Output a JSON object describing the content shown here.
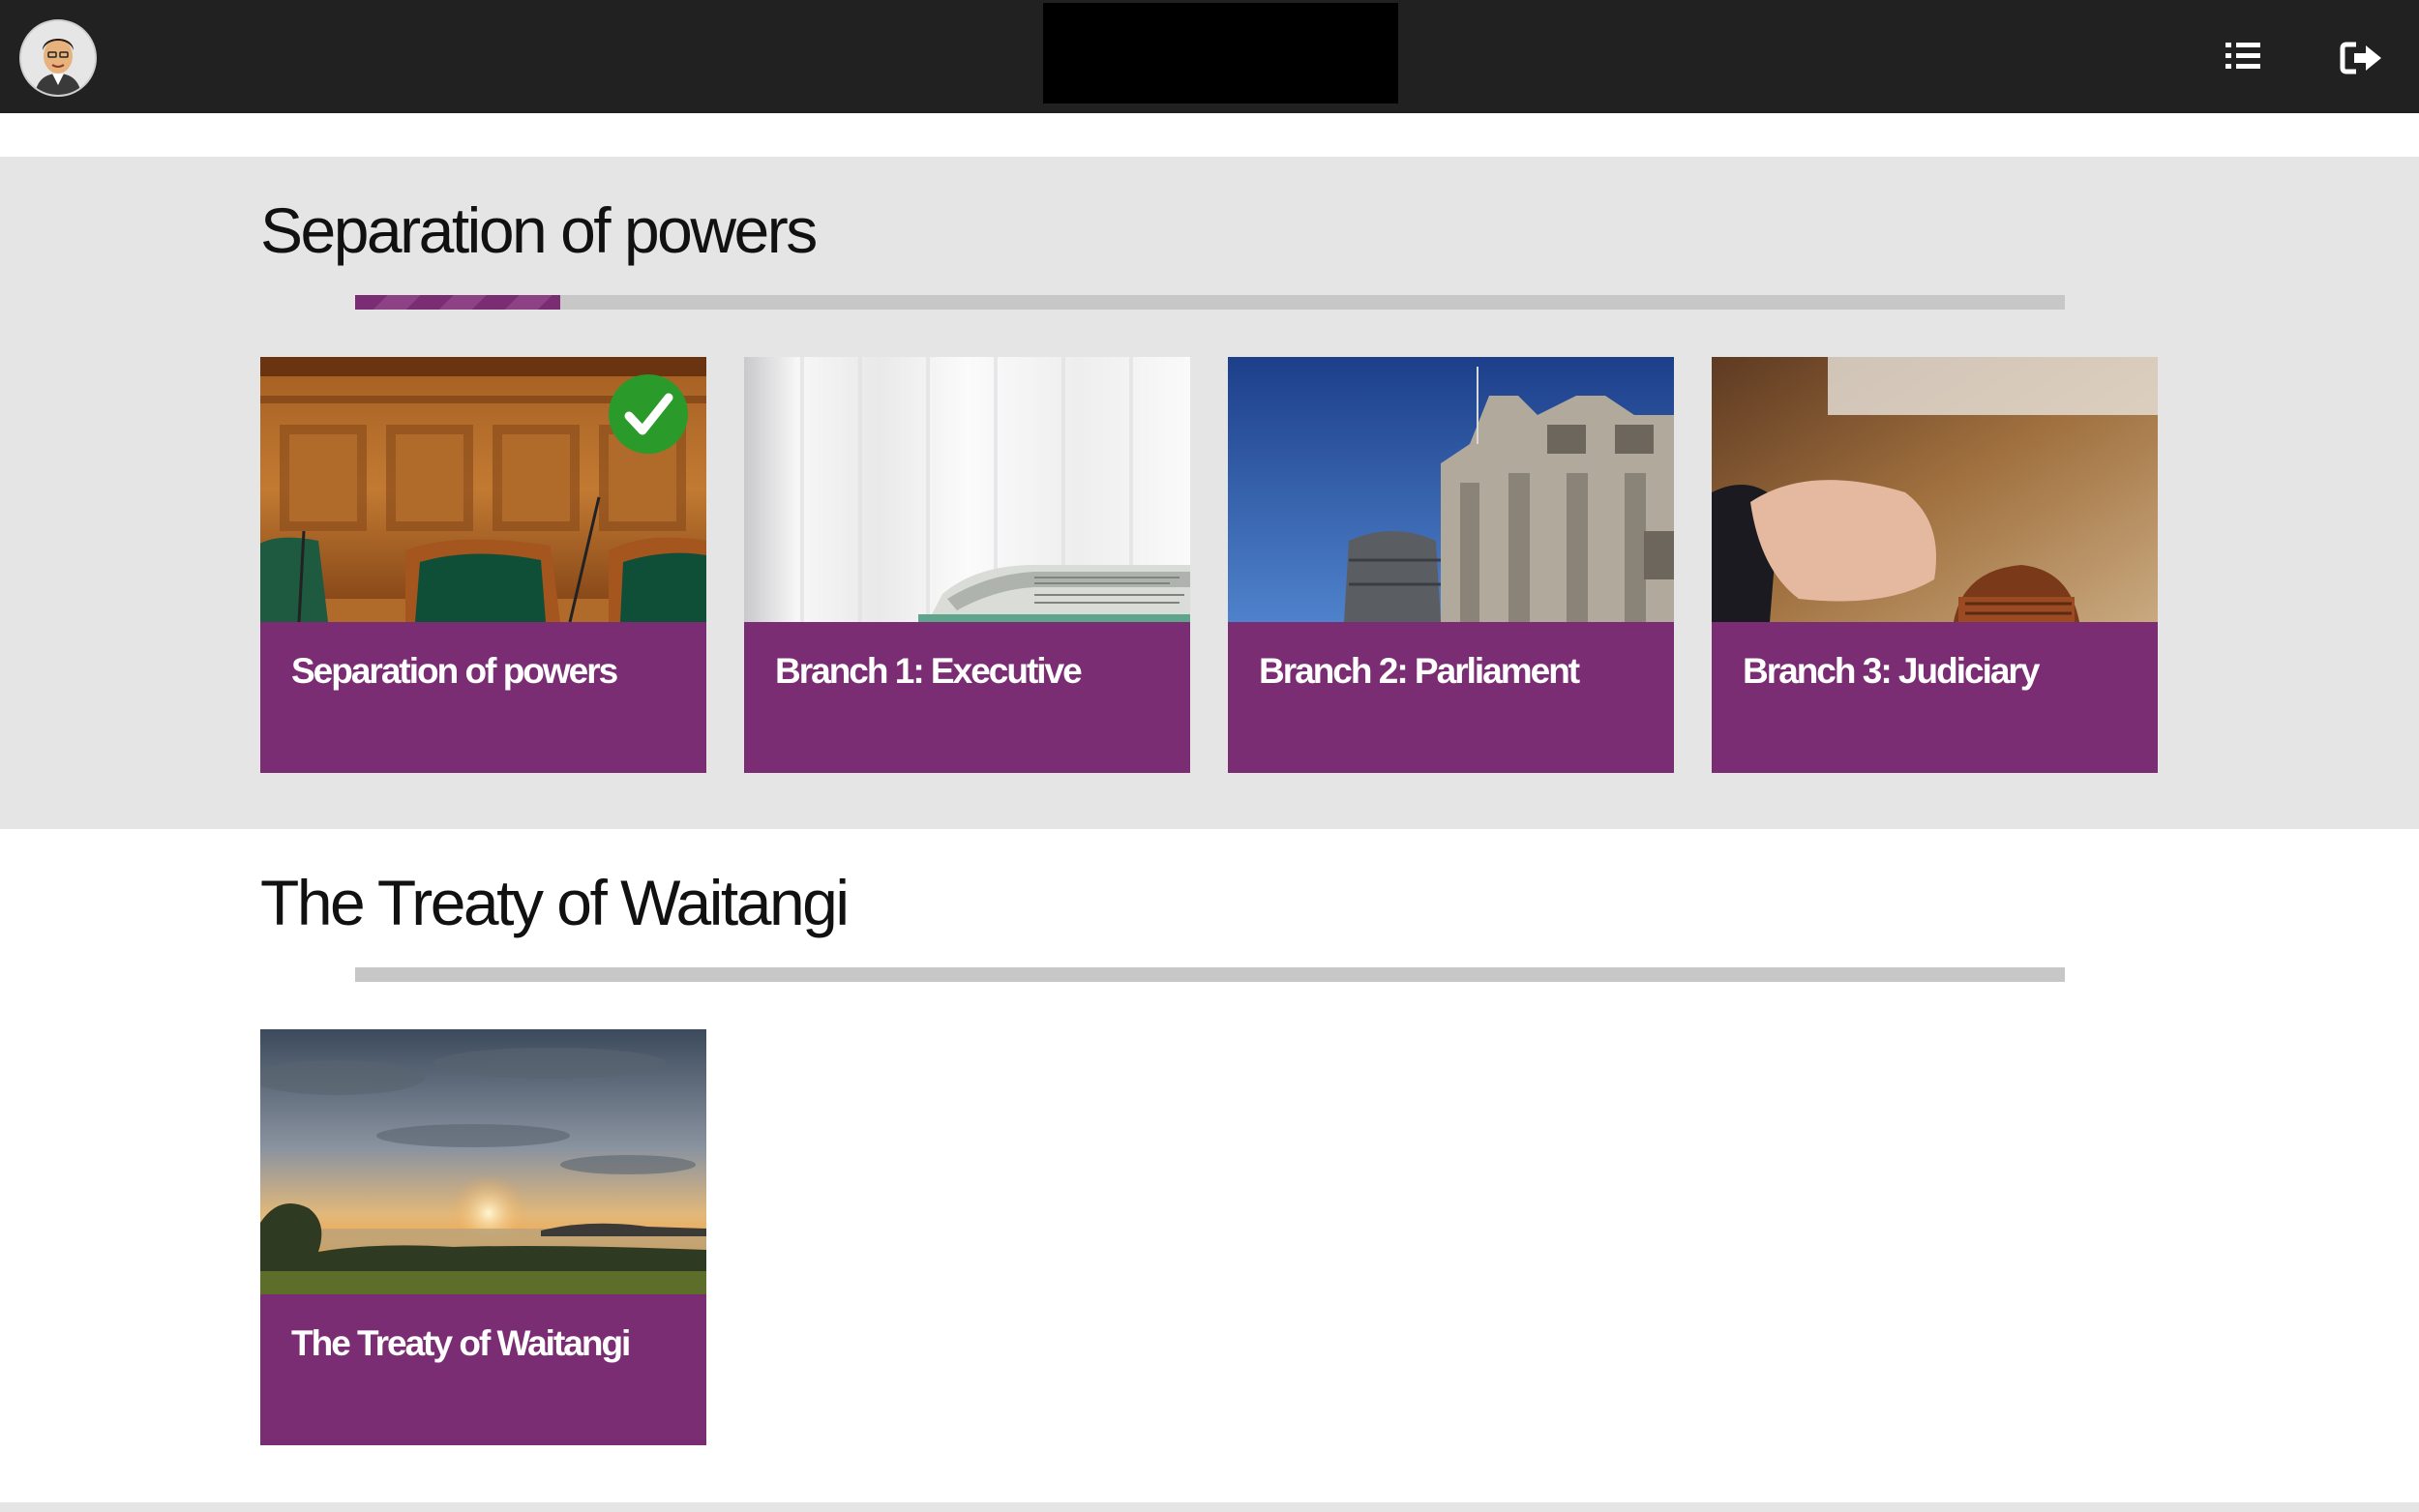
{
  "header": {
    "avatar_icon": "user-avatar-icon",
    "menu_icon": "list-icon",
    "logout_icon": "sign-out-icon"
  },
  "sections": [
    {
      "title": "Separation of powers",
      "progress": 0.12,
      "cards": [
        {
          "label": "Separation of powers",
          "image": "parliament-chamber-seats",
          "completed": true
        },
        {
          "label": "Branch 1: Executive",
          "image": "folded-newspaper"
        },
        {
          "label": "Branch 2: Parliament",
          "image": "parliament-buildings"
        },
        {
          "label": "Branch 3: Judiciary",
          "image": "judge-gavel"
        }
      ]
    },
    {
      "title": "The Treaty of Waitangi",
      "progress": 0,
      "cards": [
        {
          "label": "The Treaty of Waitangi",
          "image": "sunset-landscape"
        }
      ]
    }
  ],
  "colors": {
    "topbar": "#212121",
    "accent": "#7b2d73",
    "section_grey": "#e5e5e5",
    "progress_track": "#c7c7c7",
    "complete_green": "#2a9a2a"
  },
  "icons": {
    "completed": "check-circle-icon"
  }
}
